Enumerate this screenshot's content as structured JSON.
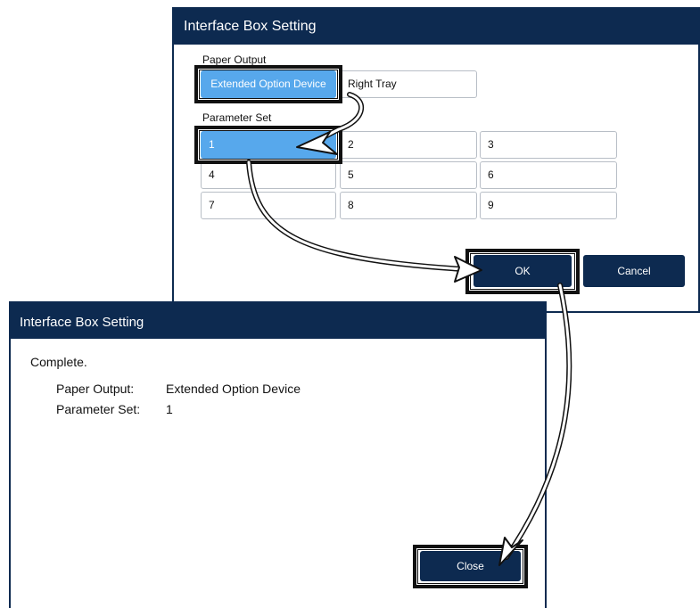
{
  "setting_dialog": {
    "title": "Interface Box Setting",
    "paper_output_label": "Paper Output",
    "paper_output_options": [
      "Extended Option Device",
      "Right Tray"
    ],
    "selected_paper_output": "Extended Option Device",
    "parameter_set_label": "Parameter Set",
    "parameter_sets": [
      "1",
      "2",
      "3",
      "4",
      "5",
      "6",
      "7",
      "8",
      "9"
    ],
    "selected_parameter_set": "1",
    "ok_label": "OK",
    "cancel_label": "Cancel"
  },
  "complete_dialog": {
    "title": "Interface Box Setting",
    "message": "Complete.",
    "paper_output_key": "Paper Output:",
    "paper_output_value": "Extended Option Device",
    "parameter_set_key": "Parameter Set:",
    "parameter_set_value": "1",
    "close_label": "Close"
  },
  "colors": {
    "title_bar": "#0d2a50",
    "selected": "#57a8ec",
    "button": "#0d2a50"
  }
}
